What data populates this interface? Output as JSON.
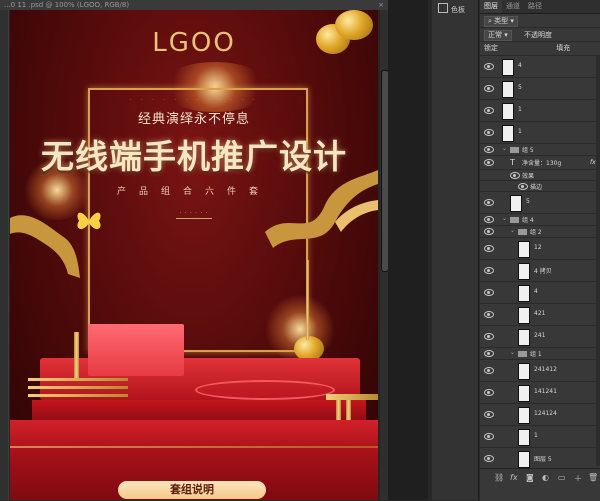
{
  "document_tab": {
    "title": "...0 11 .psd @ 100% (LGOO, RGB/8)"
  },
  "poster": {
    "logo": "LGOO",
    "subtitle": "经典演绎永不停息",
    "title": "无线端手机推广设计",
    "series": "产品组合六件套",
    "caption": "套组说明"
  },
  "color_panel": {
    "label": "色板"
  },
  "layers_panel": {
    "tabs": [
      "图层",
      "通道",
      "路径"
    ],
    "filter_kind": "类型",
    "blend_mode": "正常",
    "opacity_label": "不透明度",
    "lock_label": "锁定",
    "fill_label": "填充",
    "layers": [
      {
        "name": "4",
        "type": "layer",
        "indent": 0
      },
      {
        "name": "5",
        "type": "layer",
        "indent": 0
      },
      {
        "name": "1",
        "type": "layer",
        "indent": 0
      },
      {
        "name": "1",
        "type": "layer",
        "indent": 0
      },
      {
        "name": "组 5",
        "type": "group",
        "indent": 0
      },
      {
        "name": "净含量：130g",
        "type": "text",
        "indent": 1
      },
      {
        "name": "效果",
        "type": "effect",
        "indent": 2
      },
      {
        "name": "描边",
        "type": "effect",
        "indent": 3
      },
      {
        "name": "5",
        "type": "layer",
        "indent": 1
      },
      {
        "name": "组 4",
        "type": "group",
        "indent": 0
      },
      {
        "name": "组 2",
        "type": "group",
        "indent": 1
      },
      {
        "name": "12",
        "type": "layer",
        "indent": 2
      },
      {
        "name": "4 拷贝",
        "type": "layer",
        "indent": 2
      },
      {
        "name": "4",
        "type": "layer",
        "indent": 2
      },
      {
        "name": "421",
        "type": "layer",
        "indent": 2
      },
      {
        "name": "241",
        "type": "layer",
        "indent": 2
      },
      {
        "name": "组 1",
        "type": "group",
        "indent": 1
      },
      {
        "name": "241412",
        "type": "layer",
        "indent": 2
      },
      {
        "name": "141241",
        "type": "layer",
        "indent": 2
      },
      {
        "name": "124124",
        "type": "layer",
        "indent": 2
      },
      {
        "name": "1",
        "type": "layer",
        "indent": 2
      },
      {
        "name": "图层 5",
        "type": "layer",
        "indent": 2
      }
    ],
    "footer_icons": [
      "link-icon",
      "fx-icon",
      "mask-icon",
      "adjustment-icon",
      "folder-icon",
      "new-layer-icon",
      "trash-icon"
    ]
  },
  "colors": {
    "accent_gold": "#e8c27a",
    "poster_red": "#5a0c0c",
    "panel_bg": "#383838"
  }
}
